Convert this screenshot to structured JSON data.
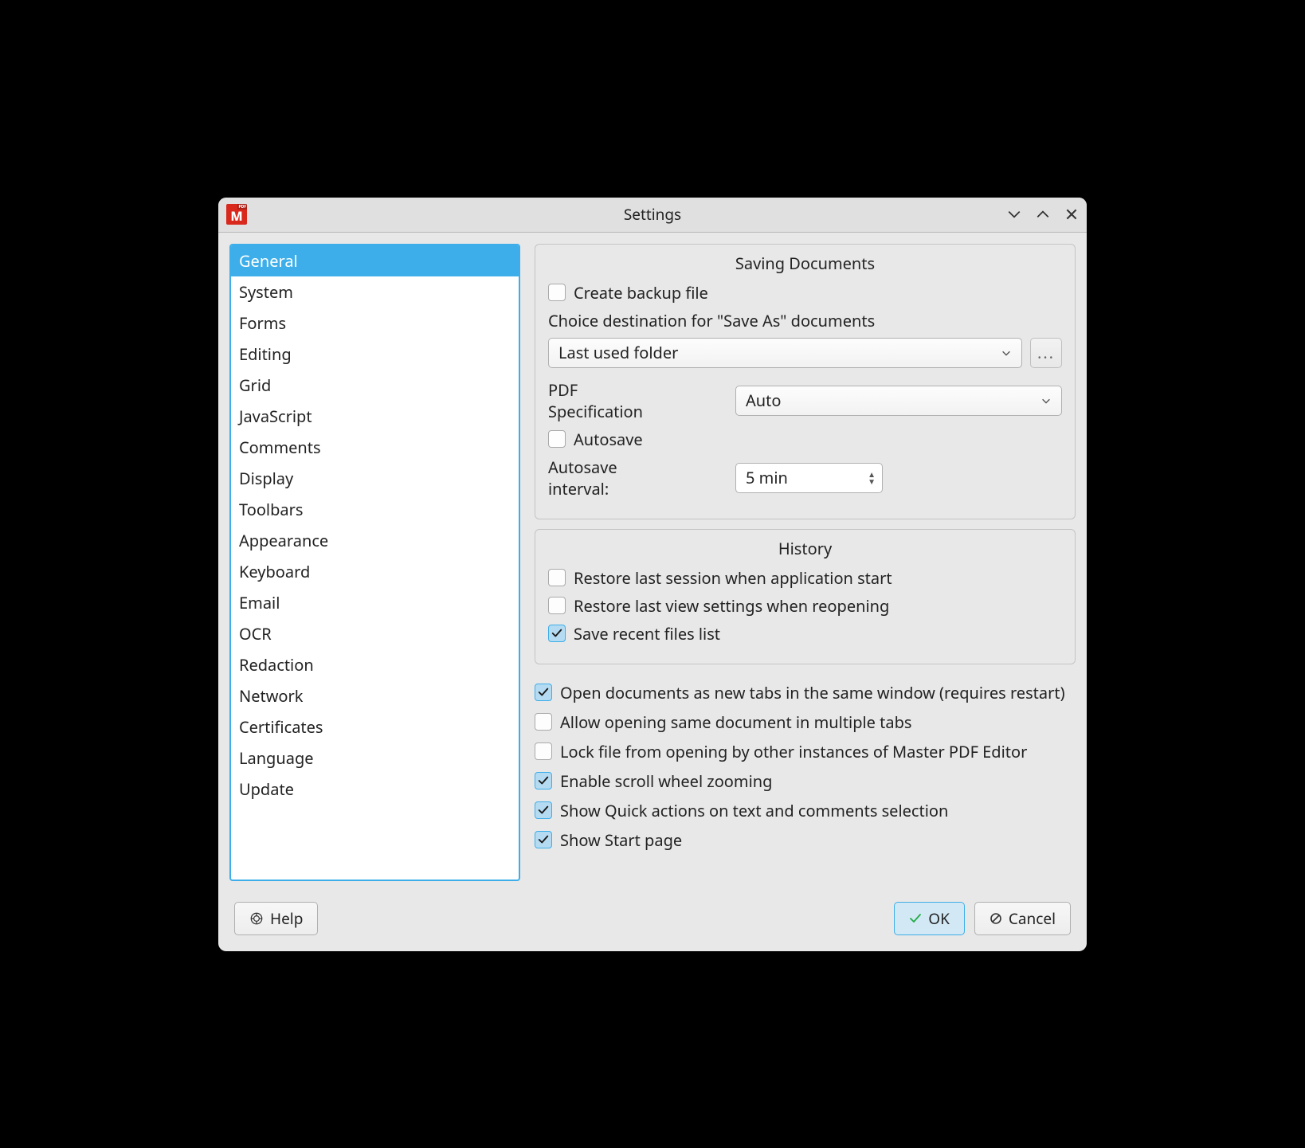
{
  "window": {
    "title": "Settings"
  },
  "sidebar": {
    "items": [
      {
        "label": "General",
        "selected": true
      },
      {
        "label": "System"
      },
      {
        "label": "Forms"
      },
      {
        "label": "Editing"
      },
      {
        "label": "Grid"
      },
      {
        "label": "JavaScript"
      },
      {
        "label": "Comments"
      },
      {
        "label": "Display"
      },
      {
        "label": "Toolbars"
      },
      {
        "label": "Appearance"
      },
      {
        "label": "Keyboard"
      },
      {
        "label": "Email"
      },
      {
        "label": "OCR"
      },
      {
        "label": "Redaction"
      },
      {
        "label": "Network"
      },
      {
        "label": "Certificates"
      },
      {
        "label": "Language"
      },
      {
        "label": "Update"
      }
    ]
  },
  "saving": {
    "title": "Saving Documents",
    "create_backup_label": "Create backup file",
    "create_backup_checked": false,
    "destination_caption": "Choice destination for \"Save As\" documents",
    "destination_value": "Last used folder",
    "browse_label": "...",
    "pdf_spec_label": "PDF Specification",
    "pdf_spec_value": "Auto",
    "autosave_label": "Autosave",
    "autosave_checked": false,
    "autosave_interval_label": "Autosave interval:",
    "autosave_interval_value": "5 min"
  },
  "history": {
    "title": "History",
    "restore_session_label": "Restore last session when application start",
    "restore_session_checked": false,
    "restore_view_label": "Restore last view settings when reopening",
    "restore_view_checked": false,
    "save_recent_label": "Save recent files list",
    "save_recent_checked": true
  },
  "general_checks": [
    {
      "label": "Open documents as new tabs in the same window (requires restart)",
      "checked": true
    },
    {
      "label": "Allow opening same document in multiple tabs",
      "checked": false
    },
    {
      "label": "Lock file from opening by other instances of Master PDF Editor",
      "checked": false
    },
    {
      "label": "Enable scroll wheel zooming",
      "checked": true
    },
    {
      "label": "Show Quick actions on text and comments selection",
      "checked": true
    },
    {
      "label": "Show Start page",
      "checked": true
    }
  ],
  "buttons": {
    "help": "Help",
    "ok": "OK",
    "cancel": "Cancel"
  }
}
